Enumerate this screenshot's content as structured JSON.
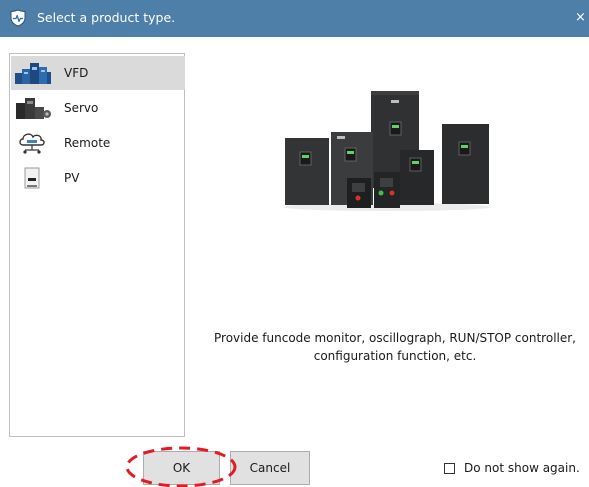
{
  "dialog": {
    "title": "Select a product type.",
    "close_glyph": "×",
    "title_icon": "pulse-shield-icon",
    "titlebar_color": "#4e7fa8"
  },
  "product_list": {
    "selected": "VFD",
    "items": [
      {
        "label": "VFD",
        "icon": "vfd-icon",
        "selected": true
      },
      {
        "label": "Servo",
        "icon": "servo-icon",
        "selected": false
      },
      {
        "label": "Remote",
        "icon": "cloud-remote-icon",
        "selected": false
      },
      {
        "label": "PV",
        "icon": "pv-inverter-icon",
        "selected": false
      }
    ]
  },
  "preview": {
    "image": "vfd-product-family-image",
    "description": "Provide funcode monitor, oscillograph, RUN/STOP controller, configuration function, etc."
  },
  "buttons": {
    "ok": "OK",
    "cancel": "Cancel"
  },
  "annotation": {
    "type": "dashed-ellipse-highlight",
    "target": "ok-button",
    "color": "#e31b23"
  },
  "dont_show_again": {
    "label": "Do not show again.",
    "checked": false
  }
}
